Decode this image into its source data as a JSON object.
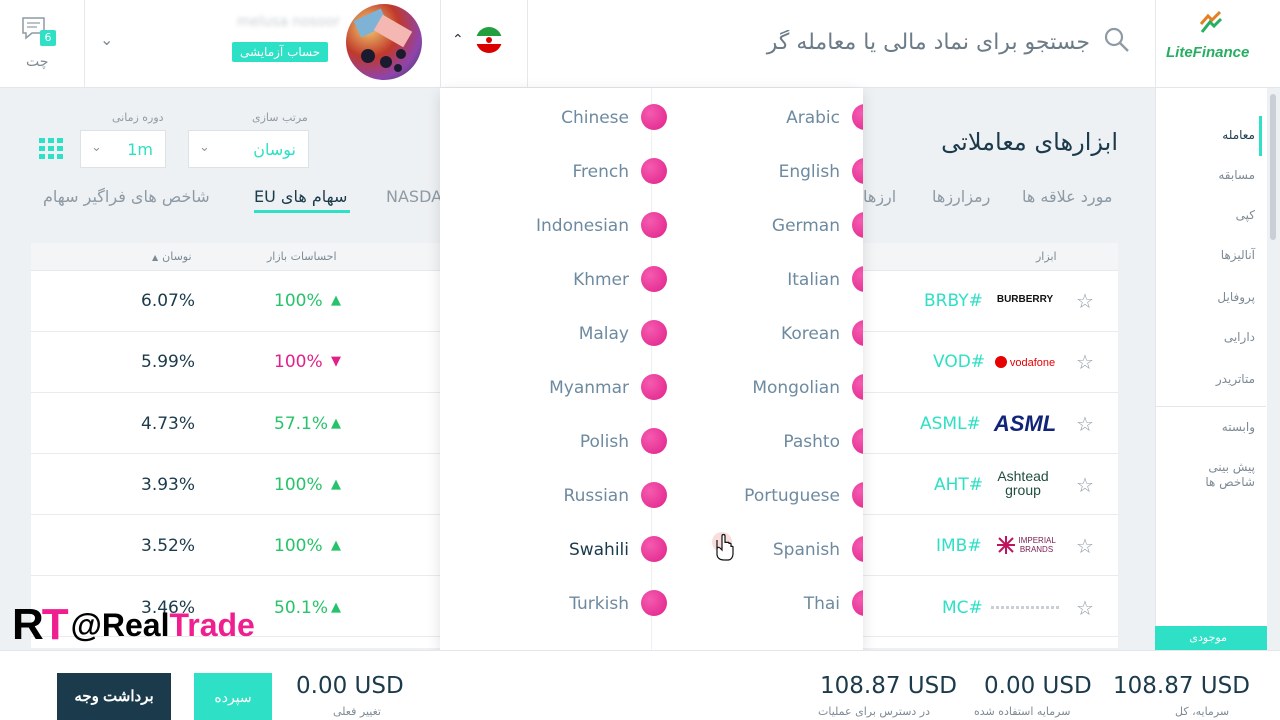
{
  "header": {
    "brand": "LiteFinance",
    "search_placeholder": "جستجو برای نماد مالی یا معامله گر",
    "user_name": "melusa nosoor",
    "demo_badge": "حساب آزمایشی",
    "chat_label": "چت",
    "chat_count": "6"
  },
  "sidebar": {
    "items": [
      "معامله",
      "مسابقه",
      "کپی",
      "آنالیزها",
      "پروفایل",
      "دارایی",
      "متاتریدر",
      "وابسته",
      "پیش بینی شاخص ها"
    ],
    "bottom": "موجودی"
  },
  "main": {
    "title": "ابزارهای معاملاتی",
    "sort_label": "مرتب سازی",
    "sort_value": "نوسان",
    "period_label": "دوره زمانی",
    "period_value": "1m",
    "tabs": [
      "مورد علاقه ها",
      "رمزارزها",
      "ارزها",
      "NASDAQ",
      "سهام های EU",
      "شاخص های فراگیر سهام"
    ],
    "columns": {
      "instrument": "ابزار",
      "sentiment": "احساسات بازار",
      "volatility": "نوسان"
    }
  },
  "rows": [
    {
      "symbol": "BRBY#",
      "brand": "BURBERRY",
      "sentiment": "100%",
      "direction": "up",
      "volatility": "6.07%"
    },
    {
      "symbol": "VOD#",
      "brand": "vodafone",
      "sentiment": "100%",
      "direction": "down",
      "volatility": "5.99%"
    },
    {
      "symbol": "ASML#",
      "brand": "ASML",
      "sentiment": "57.1%",
      "direction": "up",
      "volatility": "4.73%"
    },
    {
      "symbol": "AHT#",
      "brand": "Ashtead group",
      "sentiment": "100%",
      "direction": "up",
      "volatility": "3.93%"
    },
    {
      "symbol": "IMB#",
      "brand": "IMPERIAL BRANDS",
      "sentiment": "100%",
      "direction": "up",
      "volatility": "3.52%"
    },
    {
      "symbol": "MC#",
      "brand": "",
      "sentiment": "50.1%",
      "direction": "up",
      "volatility": "3.46%"
    }
  ],
  "languages": {
    "left": [
      "Chinese",
      "French",
      "Indonesian",
      "Khmer",
      "Malay",
      "Myanmar",
      "Polish",
      "Russian",
      "Swahili",
      "Turkish"
    ],
    "right": [
      "Arabic",
      "English",
      "German",
      "Italian",
      "Korean",
      "Mongolian",
      "Pashto",
      "Portuguese",
      "Spanish",
      "Thai"
    ]
  },
  "bottom": {
    "withdraw": "برداشت وجه",
    "deposit": "سپرده",
    "stats": [
      {
        "value": "0.00 USD",
        "label": "تغییر فعلی"
      },
      {
        "value": "108.87 USD",
        "label": "در دسترس برای عملیات"
      },
      {
        "value": "0.00 USD",
        "label": "سرمایه استفاده شده"
      },
      {
        "value": "108.87 USD",
        "label": "سرمایه، کل"
      }
    ]
  },
  "watermark": "RT @RealTrade",
  "colors": {
    "accent": "#2ee0c5",
    "navy": "#1b3a4b",
    "up": "#27c36a",
    "down": "#e0218a",
    "flag": "#e0218a"
  }
}
